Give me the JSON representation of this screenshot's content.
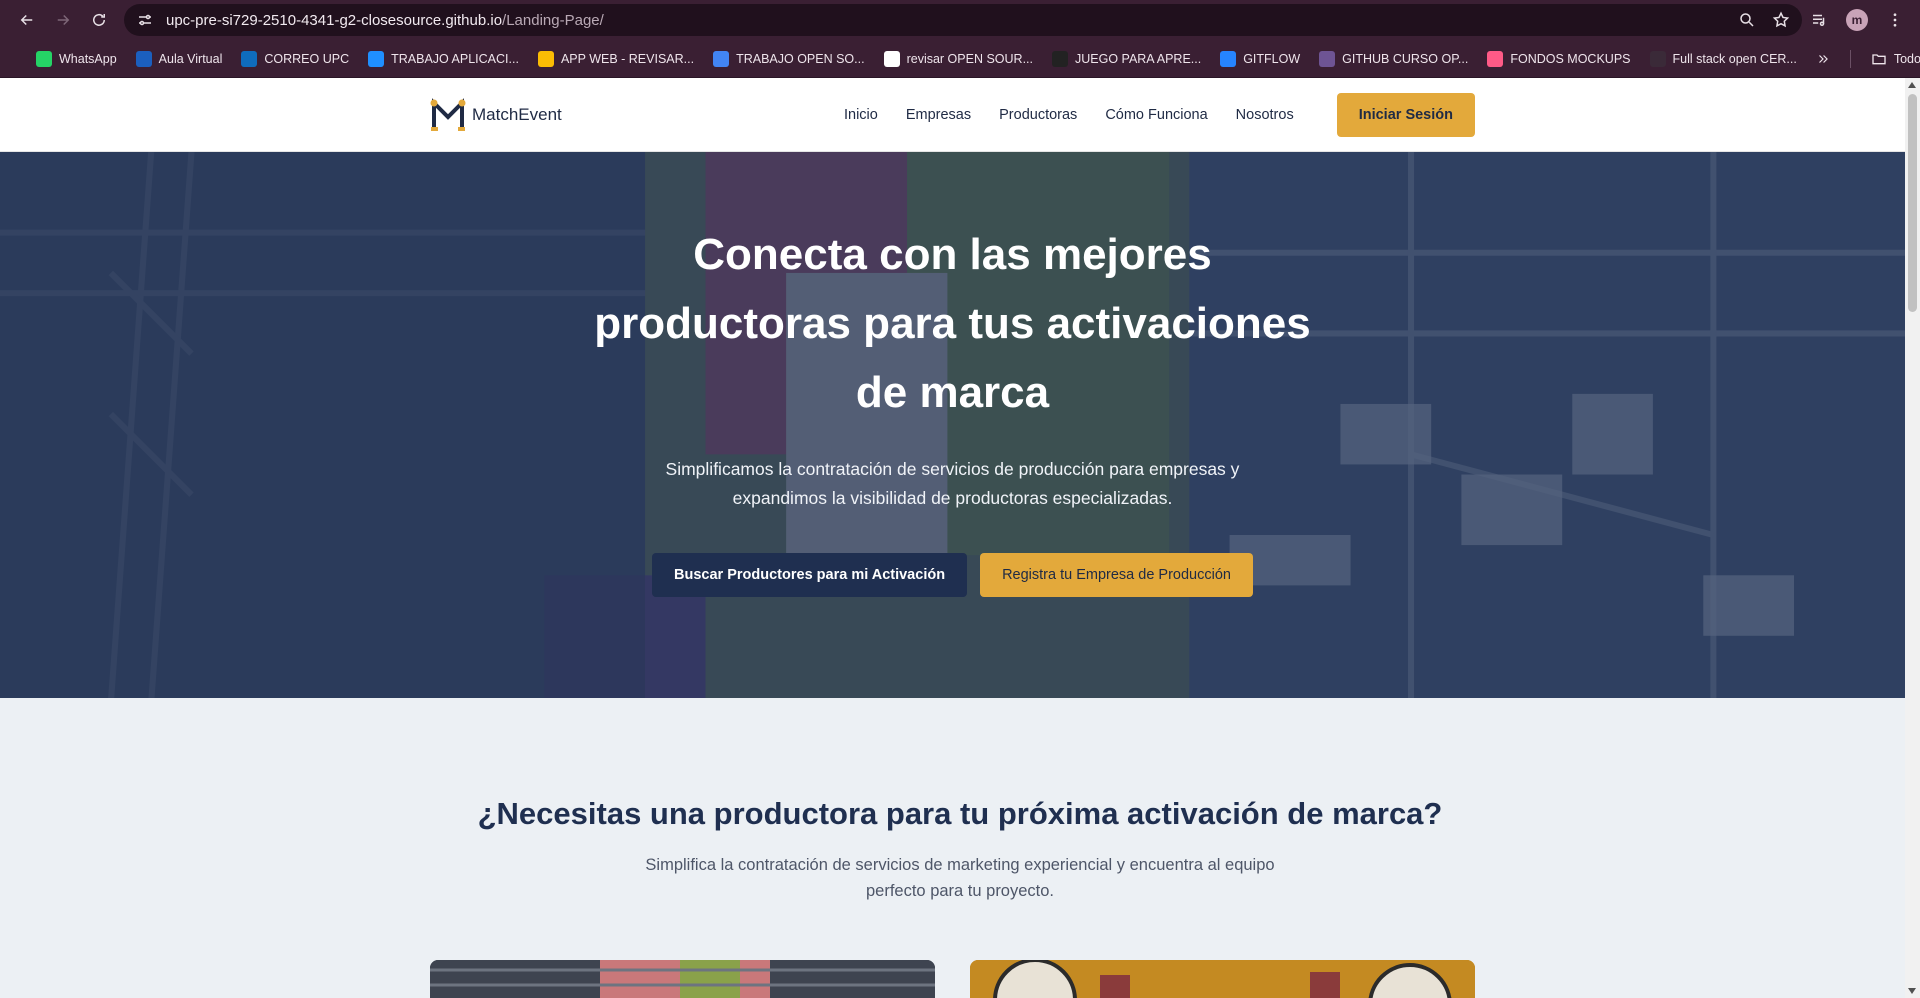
{
  "browser": {
    "url_host": "upc-pre-si729-2510-4341-g2-closesource.github.io",
    "url_path": "/Landing-Page/",
    "profile_initial": "m",
    "bookmarks": [
      {
        "label": "WhatsApp",
        "color": "#25d366"
      },
      {
        "label": "Aula Virtual",
        "color": "#1b5fbf"
      },
      {
        "label": "CORREO UPC",
        "color": "#0f6cbd"
      },
      {
        "label": "TRABAJO APLICACI...",
        "color": "#1f8fff"
      },
      {
        "label": "APP WEB - REVISAR...",
        "color": "#fbbc04"
      },
      {
        "label": "TRABAJO OPEN SO...",
        "color": "#4285f4"
      },
      {
        "label": "revisar OPEN SOUR...",
        "color": "#ffffff"
      },
      {
        "label": "JUEGO PARA APRE...",
        "color": "#222222"
      },
      {
        "label": "GITFLOW",
        "color": "#2684ff"
      },
      {
        "label": "GITHUB CURSO OP...",
        "color": "#6e5494"
      },
      {
        "label": "FONDOS MOCKUPS",
        "color": "#ff5a87"
      },
      {
        "label": "Full stack open CER...",
        "color": "#3a2a38"
      }
    ],
    "all_bookmarks_label": "Todos los favoritos"
  },
  "header": {
    "logo_text": "MatchEvent",
    "nav": [
      "Inicio",
      "Empresas",
      "Productoras",
      "Cómo Funciona",
      "Nosotros"
    ],
    "login_label": "Iniciar Sesión"
  },
  "hero": {
    "title": "Conecta con las mejores productoras para tus activaciones de marca",
    "subtitle": "Simplificamos la contratación de servicios de producción para empresas y expandimos la visibilidad de productoras especializadas.",
    "primary_cta": "Buscar Productores para mi Activación",
    "secondary_cta": "Registra tu Empresa de Producción"
  },
  "section": {
    "title": "¿Necesitas una productora para tu próxima activación de marca?",
    "subtitle": "Simplifica la contratación de servicios de marketing experiencial y encuentra al equipo perfecto para tu proyecto."
  },
  "colors": {
    "chrome": "#3a1f33",
    "brand_navy": "#1f2f50",
    "brand_gold": "#e3a93b",
    "section_bg": "#ecf0f4"
  }
}
